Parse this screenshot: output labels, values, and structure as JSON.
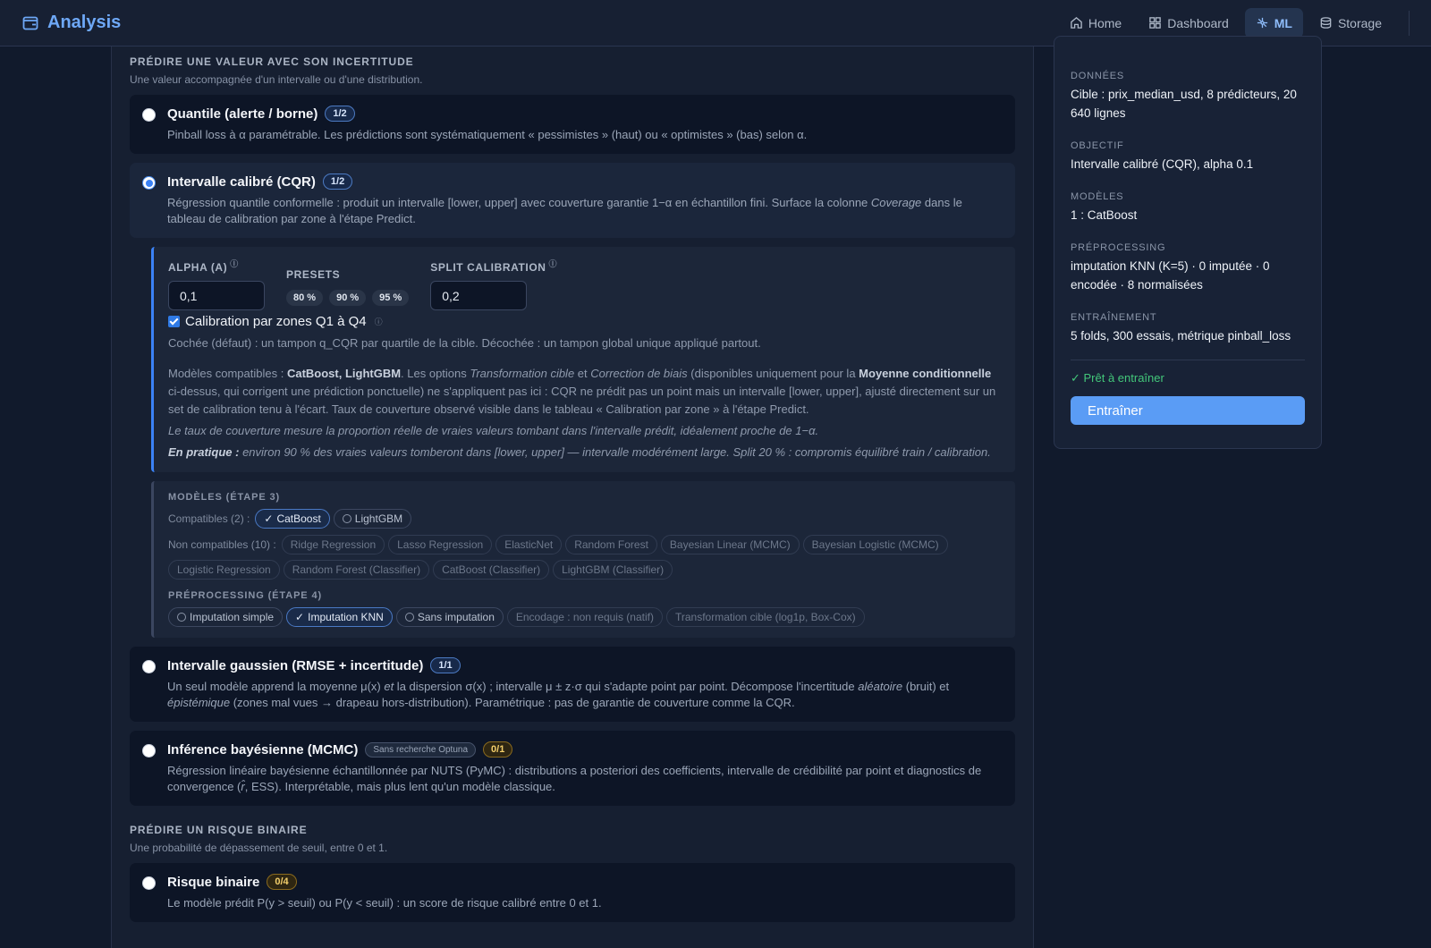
{
  "app": {
    "title": "Analysis"
  },
  "nav": {
    "items": [
      {
        "label": "Home",
        "icon": "home-icon"
      },
      {
        "label": "Dashboard",
        "icon": "dashboard-icon"
      },
      {
        "label": "ML",
        "icon": "ml-icon",
        "active": true
      },
      {
        "label": "Storage",
        "icon": "storage-icon"
      }
    ]
  },
  "uncertainty": {
    "title": "PRÉDIRE UNE VALEUR AVEC SON INCERTITUDE",
    "subtitle": "Une valeur accompagnée d'un intervalle ou d'une distribution.",
    "quantile": {
      "title": "Quantile (alerte / borne)",
      "badge": "1/2",
      "desc": "Pinball loss à α paramétrable. Les prédictions sont systématiquement « pessimistes » (haut) ou « optimistes » (bas) selon α."
    },
    "cqr": {
      "title": "Intervalle calibré (CQR)",
      "badge": "1/2",
      "desc_a": "Régression quantile conformelle : produit un intervalle [lower, upper] avec couverture garantie 1−α en échantillon fini. Surface la colonne ",
      "desc_em": "Coverage",
      "desc_b": " dans le tableau de calibration par zone à l'étape Predict."
    },
    "config": {
      "alpha_label": "ALPHA (Α)",
      "alpha_value": "0,1",
      "presets_label": "PRESETS",
      "presets": [
        "80 %",
        "90 %",
        "95 %"
      ],
      "split_label": "SPLIT CALIBRATION",
      "split_value": "0,2",
      "zones_label": "Calibration par zones Q1 à Q4",
      "zones_checked": true,
      "zones_help": "Cochée (défaut) : un tampon q_CQR par quartile de la cible. Décochée : un tampon global unique appliqué partout.",
      "compat_p1": "Modèles compatibles : ",
      "compat_b1": "CatBoost, LightGBM",
      "compat_p2": ". Les options ",
      "compat_i1": "Transformation cible",
      "compat_p3": " et ",
      "compat_i2": "Correction de biais",
      "compat_p4": " (disponibles uniquement pour la ",
      "compat_b2": "Moyenne conditionnelle",
      "compat_p5": " ci-dessus, qui corrigent une prédiction ponctuelle) ne s'appliquent pas ici : CQR ne prédit pas un point mais un intervalle [lower, upper], ajusté directement sur un set de calibration tenu à l'écart. Taux de couverture observé visible dans le tableau « Calibration par zone » à l'étape Predict.",
      "coverage_note": "Le taux de couverture mesure la proportion réelle de vraies valeurs tombant dans l'intervalle prédit, idéalement proche de 1−α.",
      "practice_label": "En pratique :",
      "practice_text": " environ 90 % des vraies valeurs tomberont dans [lower, upper] — intervalle modérément large. Split 20 % : compromis équilibré train / calibration."
    },
    "models": {
      "title": "MODÈLES (ÉTAPE 3)",
      "compat_label": "Compatibles (2) :",
      "compat": [
        {
          "label": "CatBoost",
          "selected": true
        },
        {
          "label": "LightGBM",
          "selected": false
        }
      ],
      "noncompat_label": "Non compatibles (10) :",
      "noncompat": [
        "Ridge Regression",
        "Lasso Regression",
        "ElasticNet",
        "Random Forest",
        "Bayesian Linear (MCMC)",
        "Bayesian Logistic (MCMC)",
        "Logistic Regression",
        "Random Forest (Classifier)",
        "CatBoost (Classifier)",
        "LightGBM (Classifier)"
      ],
      "prep_title": "PRÉPROCESSING (ÉTAPE 4)",
      "prep": [
        {
          "label": "Imputation simple",
          "selected": false
        },
        {
          "label": "Imputation KNN",
          "selected": true
        },
        {
          "label": "Sans imputation",
          "selected": false
        }
      ],
      "prep_disabled": [
        "Encodage : non requis (natif)",
        "Transformation cible (log1p, Box-Cox)"
      ]
    },
    "gaussian": {
      "title": "Intervalle gaussien (RMSE + incertitude)",
      "badge": "1/1",
      "d1": "Un seul modèle apprend la moyenne μ(x) ",
      "d1i": "et",
      "d2": " la dispersion σ(x) ; intervalle μ ± z·σ qui s'adapte point par point. Décompose l'incertitude ",
      "d2i": "aléatoire",
      "d3": " (bruit) et ",
      "d3i": "épistémique",
      "d4": " (zones mal vues → drapeau hors-distribution). Paramétrique : pas de garantie de couverture comme la CQR."
    },
    "bayes": {
      "title": "Inférence bayésienne (MCMC)",
      "tag": "Sans recherche Optuna",
      "badge": "0/1",
      "desc_a": "Régression linéaire bayésienne échantillonnée par NUTS (PyMC) : distributions a posteriori des coefficients, intervalle de crédibilité par point et diagnostics de convergence (",
      "desc_em": "r̂",
      "desc_b": ", ESS). Interprétable, mais plus lent qu'un modèle classique."
    }
  },
  "binary": {
    "title": "PRÉDIRE UN RISQUE BINAIRE",
    "subtitle": "Une probabilité de dépassement de seuil, entre 0 et 1.",
    "risk": {
      "title": "Risque binaire",
      "badge": "0/4",
      "desc": "Le modèle prédit P(y > seuil) ou P(y < seuil) : un score de risque calibré entre 0 et 1."
    }
  },
  "summary": {
    "data_label": "DONNÉES",
    "data_value": "Cible : prix_median_usd, 8 prédicteurs, 20 640 lignes",
    "objective_label": "OBJECTIF",
    "objective_value": "Intervalle calibré (CQR), alpha 0.1",
    "models_label": "MODÈLES",
    "models_value": "1 : CatBoost",
    "prep_label": "PRÉPROCESSING",
    "prep_value": "imputation KNN (K=5) · 0 imputée · 0 encodée · 8 normalisées",
    "training_label": "ENTRAÎNEMENT",
    "training_value": "5 folds, 300 essais, métrique pinball_loss",
    "ready": "✓ Prêt à entraîner",
    "train_button": "Entraîner"
  }
}
